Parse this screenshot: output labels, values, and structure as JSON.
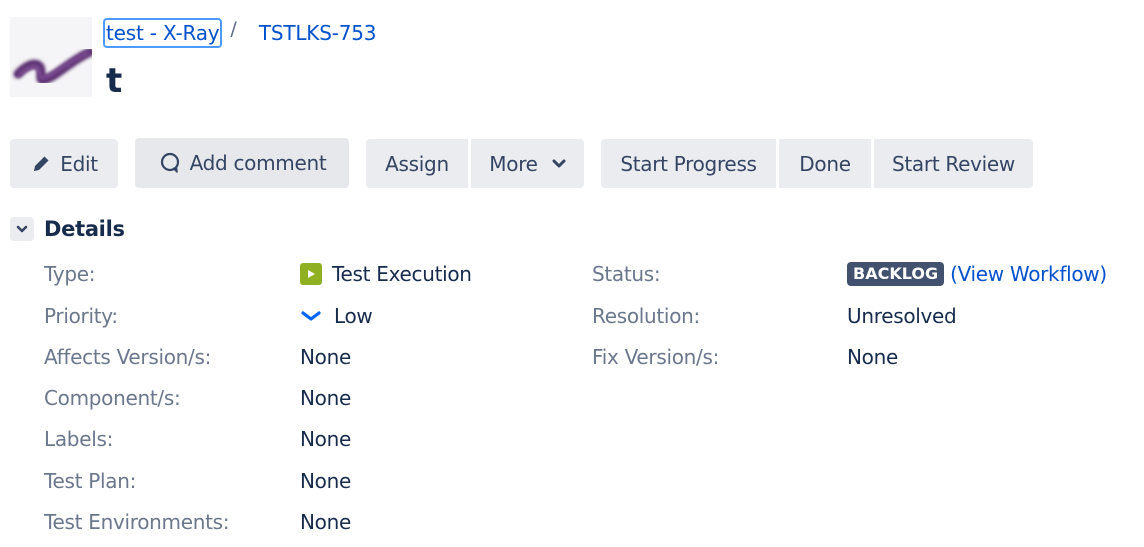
{
  "header": {
    "avatar_icon": "project-avatar-brush-stroke",
    "breadcrumb": {
      "project": "test - X-Ray",
      "separator": "/",
      "issue_key": "TSTLKS-753"
    },
    "title": "t"
  },
  "toolbar": {
    "edit": {
      "label": "Edit",
      "icon": "pencil-icon"
    },
    "add_comment": {
      "label": "Add comment",
      "icon": "comment-icon"
    },
    "assign": {
      "label": "Assign"
    },
    "more": {
      "label": "More",
      "icon": "chevron-down-icon"
    },
    "start_progress": {
      "label": "Start Progress"
    },
    "done": {
      "label": "Done"
    },
    "start_review": {
      "label": "Start Review"
    }
  },
  "details": {
    "title": "Details",
    "left": [
      {
        "label": "Type:",
        "value": "Test Execution",
        "icon": "test-execution-icon"
      },
      {
        "label": "Priority:",
        "value": "Low",
        "icon": "priority-low-icon"
      },
      {
        "label": "Affects Version/s:",
        "value": "None"
      },
      {
        "label": "Component/s:",
        "value": "None"
      },
      {
        "label": "Labels:",
        "value": "None"
      },
      {
        "label": "Test Plan:",
        "value": "None"
      },
      {
        "label": "Test Environments:",
        "value": "None"
      }
    ],
    "right": [
      {
        "label": "Status:",
        "value": "BACKLOG",
        "link": "(View Workflow)"
      },
      {
        "label": "Resolution:",
        "value": "Unresolved"
      },
      {
        "label": "Fix Version/s:",
        "value": "None"
      }
    ]
  },
  "colors": {
    "link": "#0052cc",
    "status_lozenge": "#42526e",
    "test_execution": "#8eb021",
    "priority_low": "#0065ff",
    "button_bg": "#ebecf0"
  }
}
